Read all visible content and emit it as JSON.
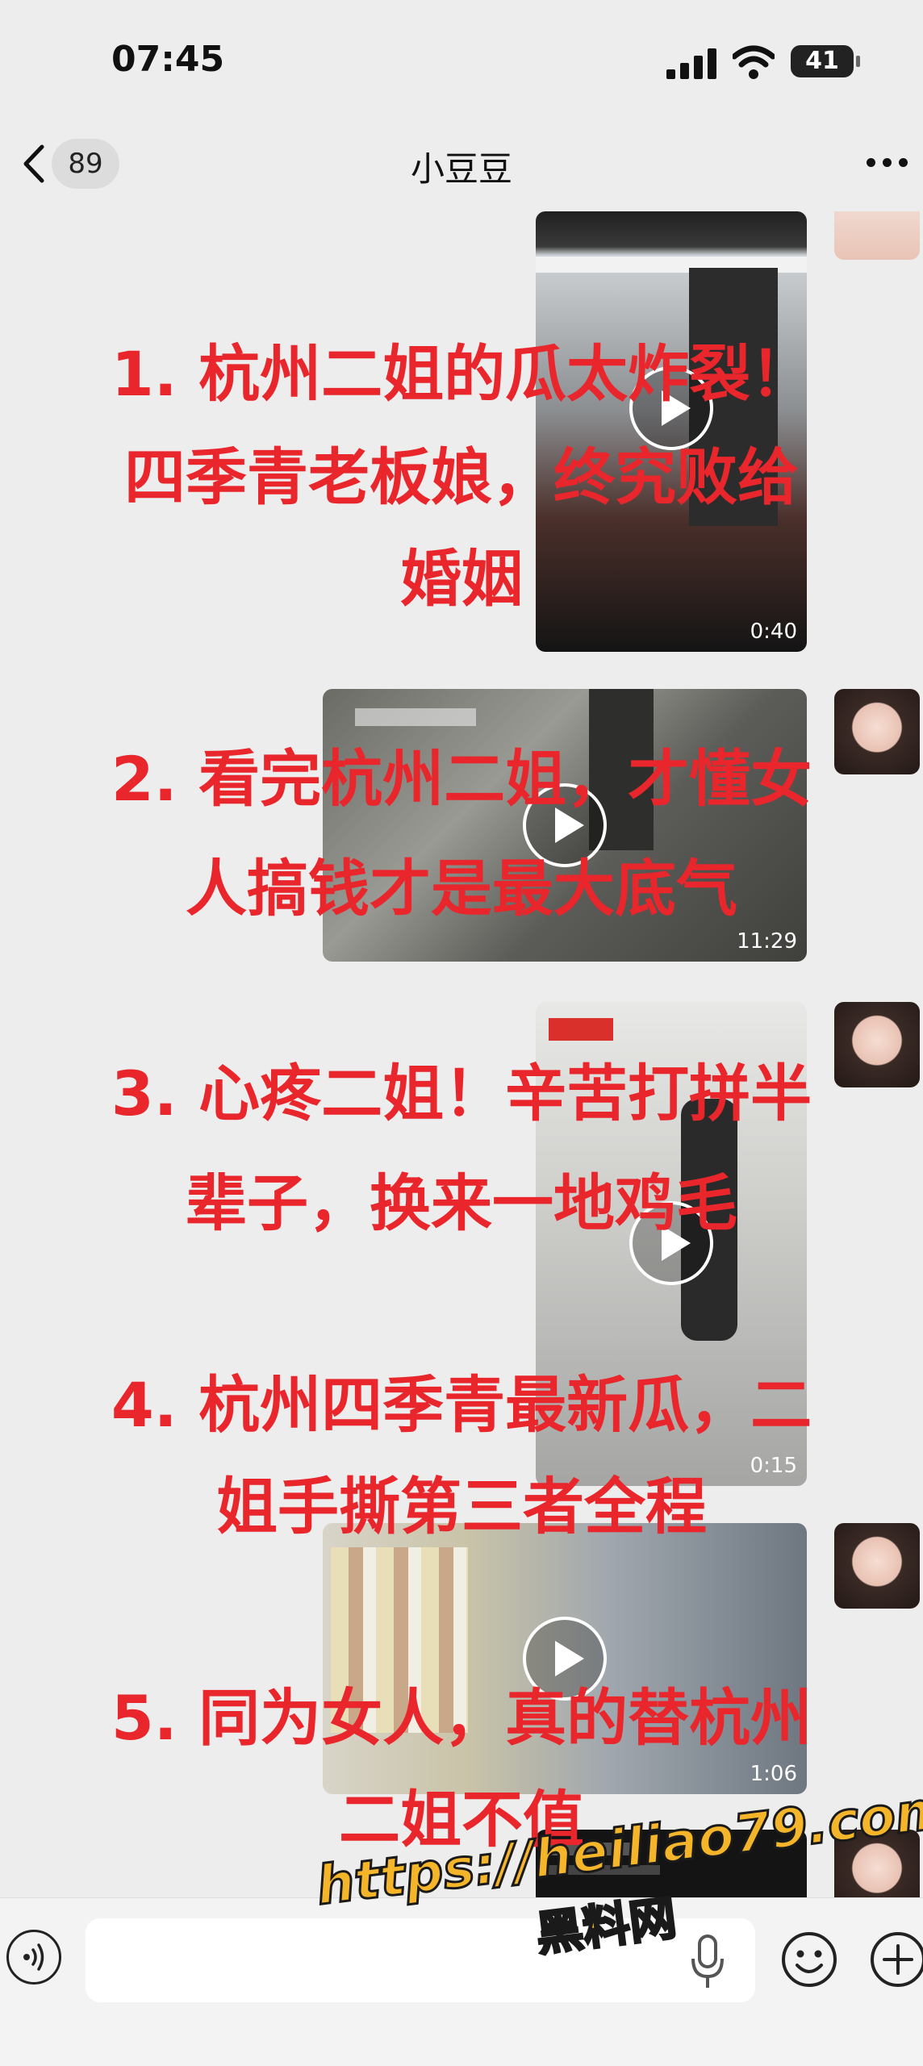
{
  "status_bar": {
    "time": "07:45",
    "battery": "41"
  },
  "nav": {
    "back_count": "89",
    "title": "小豆豆"
  },
  "videos": [
    {
      "duration": "0:40"
    },
    {
      "duration": "11:29"
    },
    {
      "duration": "0:15"
    },
    {
      "duration": "1:06"
    },
    {
      "duration": ""
    }
  ],
  "overlay": {
    "lines": [
      "1. 杭州二姐的瓜太炸裂！",
      "四季青老板娘，终究败给",
      "婚姻",
      "2. 看完杭州二姐，才懂女",
      "人搞钱才是最大底气",
      "3. 心疼二姐！辛苦打拼半",
      "辈子，换来一地鸡毛",
      "4. 杭州四季青最新瓜，二",
      "姐手撕第三者全程",
      "5. 同为女人，真的替杭州",
      "二姐不值"
    ]
  },
  "watermark": {
    "url": "https://heiliao79.com",
    "name": "黑料网"
  },
  "colors": {
    "overlay_text": "#e8262c",
    "watermark": "#f5b52a",
    "background": "#ededed"
  }
}
